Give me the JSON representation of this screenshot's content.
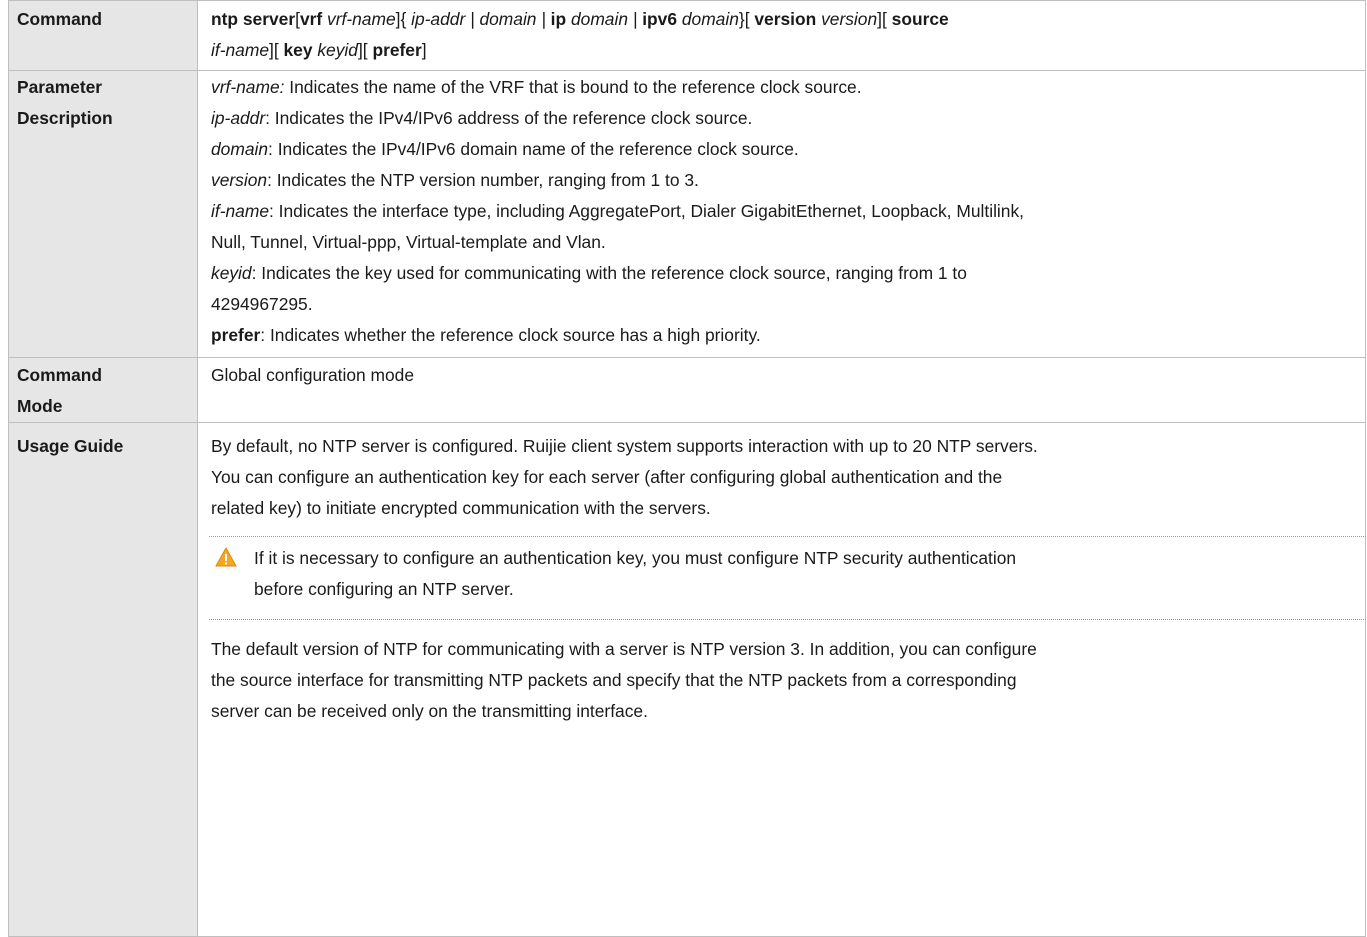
{
  "command": {
    "label": "Command",
    "syntax": {
      "ntp_server": "ntp server",
      "lb1": "[",
      "vrf": "vrf",
      "vrf_name": " vrf-name",
      "rb_lc": "]{ ",
      "ip_addr": "ip-addr",
      "pipe1": " | ",
      "domain1": "domain",
      "pipe2": " | ",
      "ip": "ip",
      "domain2": " domain",
      "pipe3": " | ",
      "ipv6": "ipv6",
      "domain3": " domain",
      "rc_lb": "}[ ",
      "version_kw": "version",
      "version_arg": " version",
      "rb_lb1": "][ ",
      "source_kw": "source",
      "if_name": "if-name",
      "rb_lb2": "][ ",
      "key_kw": "key",
      "keyid": " keyid",
      "rb_lb3": "][ ",
      "prefer": "prefer",
      "rb_end": "]"
    }
  },
  "parameter": {
    "label_line1": "Parameter",
    "label_line2": "Description",
    "items": [
      {
        "term": "vrf-name:",
        "text": " Indicates the name of the VRF that is bound to the reference clock source."
      },
      {
        "term": "ip-addr",
        "text": ": Indicates the IPv4/IPv6 address of the reference clock source."
      },
      {
        "term": "domain",
        "text": ": Indicates the IPv4/IPv6 domain name of the reference clock source."
      },
      {
        "term": "version",
        "text": ": Indicates the NTP version number, ranging from 1 to 3."
      },
      {
        "term": "if-name",
        "text": ": Indicates the interface type, including AggregatePort, Dialer GigabitEthernet, Loopback, Multilink,",
        "cont": "Null, Tunnel, Virtual-ppp, Virtual-template and Vlan."
      },
      {
        "term": "keyid",
        "text": ": Indicates the key used for communicating with the reference clock source, ranging from 1 to",
        "cont": "4294967295."
      },
      {
        "term": "prefer",
        "text": ": Indicates whether the reference clock source has a high priority."
      }
    ]
  },
  "mode": {
    "label_line1": "Command",
    "label_line2": "Mode",
    "text": "Global configuration mode"
  },
  "usage": {
    "label": "Usage Guide",
    "para1": [
      "By default, no NTP server is configured. Ruijie client system supports interaction with up to 20 NTP servers.",
      "You can configure an authentication key for each server (after configuring global authentication and the",
      "related key) to initiate encrypted communication with the servers."
    ],
    "note": [
      "If it is necessary to configure an authentication key, you must configure NTP security authentication",
      "before configuring an NTP server."
    ],
    "para2": [
      "The default version of NTP for communicating with a server is NTP version 3. In addition, you can configure",
      "the source interface for transmitting NTP packets and specify that the NTP packets from a corresponding",
      "server can be received only on the transmitting interface."
    ]
  },
  "colors": {
    "label_bg": "#e6e6e6",
    "border": "#bfbfbf",
    "warning": "#f5a623"
  }
}
